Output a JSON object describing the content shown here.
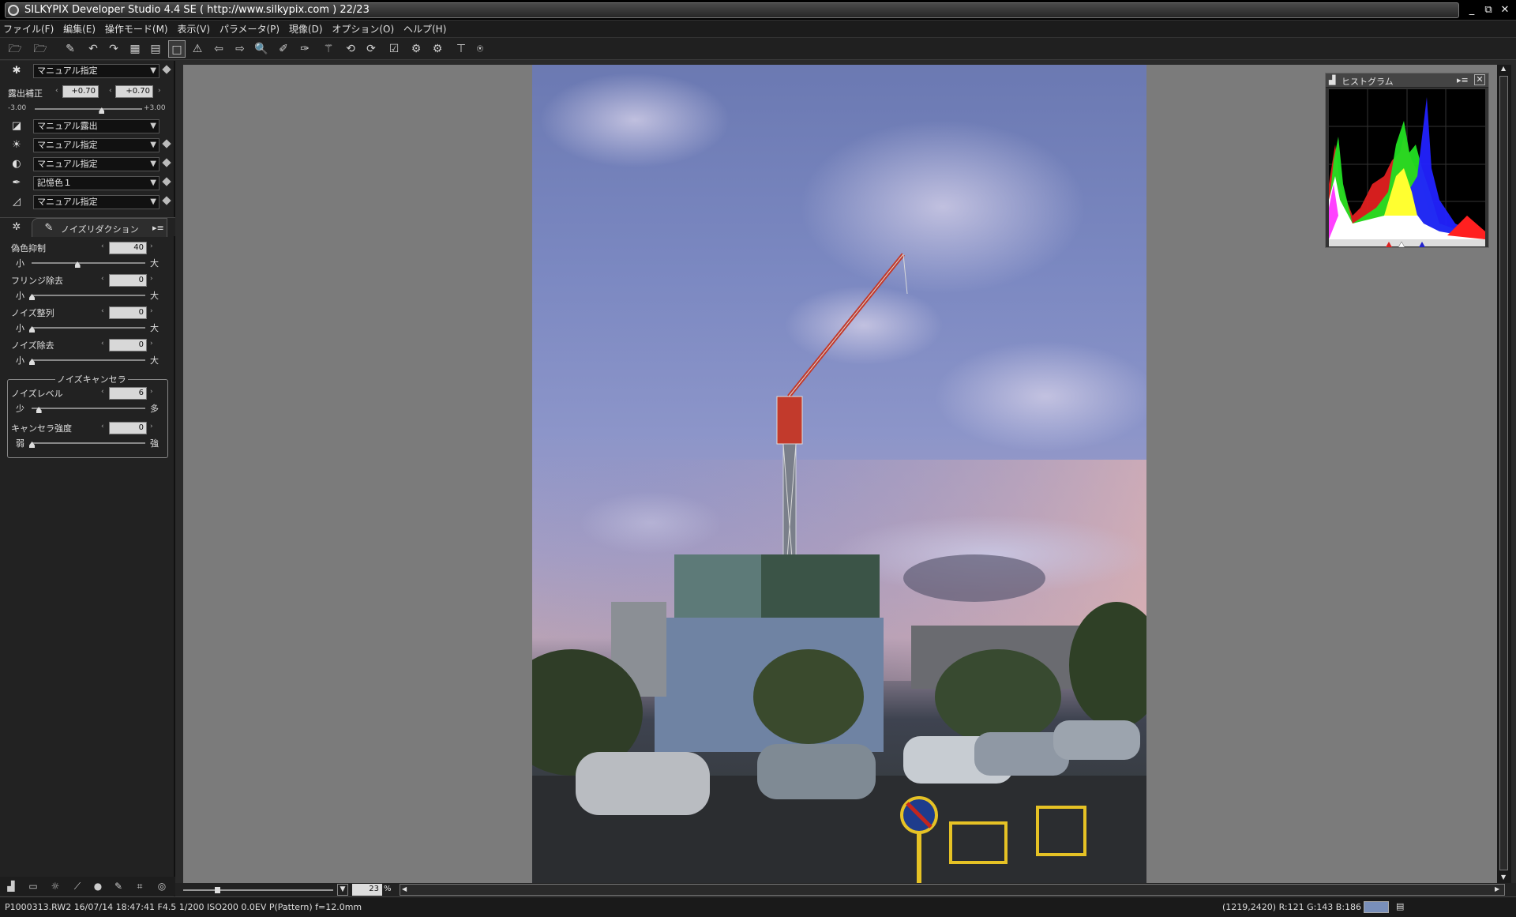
{
  "window": {
    "title": "SILKYPIX Developer Studio 4.4 SE ( http://www.silkypix.com )  22/23",
    "controls": [
      "_",
      "⧉",
      "✕"
    ]
  },
  "menu": [
    "ファイル(F)",
    "編集(E)",
    "操作モード(M)",
    "表示(V)",
    "パラメータ(P)",
    "現像(D)",
    "オプション(O)",
    "ヘルプ(H)"
  ],
  "toolbar_icons": [
    "open-folder-icon",
    "open-folder-dropdown-icon",
    "eraser-icon",
    "undo-icon",
    "redo-icon",
    "grid-view-icon",
    "filmstrip-view-icon",
    "single-view-icon",
    "warning-icon",
    "prev-icon",
    "next-icon",
    "zoom-icon",
    "picker-icon",
    "picker-plus-icon",
    "wand-icon",
    "rotate-left-icon",
    "rotate-right-icon",
    "check-icon",
    "develop-icon",
    "develop-all-icon",
    "crop-icon",
    "stamp-icon"
  ],
  "left_panel": {
    "white_balance": {
      "value": "マニュアル指定"
    },
    "exposure": {
      "label": "露出補正",
      "value1": "+0.70",
      "value2": "+0.70",
      "min": "-3.00",
      "max": "+3.00",
      "level": 0.62
    },
    "exposure_mode": {
      "value": "マニュアル露出"
    },
    "tone": {
      "value": "マニュアル指定"
    },
    "contrast": {
      "value": "マニュアル指定"
    },
    "color": {
      "value": "記憶色１"
    },
    "sharpness": {
      "value": "マニュアル指定"
    },
    "noise_tab": {
      "label": "ノイズリダクション"
    },
    "sliders": [
      {
        "label": "偽色抑制",
        "value": "40",
        "lo": "小",
        "hi": "大",
        "level": 0.4
      },
      {
        "label": "フリンジ除去",
        "value": "0",
        "lo": "小",
        "hi": "大",
        "level": 0.0
      },
      {
        "label": "ノイズ整列",
        "value": "0",
        "lo": "小",
        "hi": "大",
        "level": 0.0
      },
      {
        "label": "ノイズ除去",
        "value": "0",
        "lo": "小",
        "hi": "大",
        "level": 0.0
      }
    ],
    "canceller": {
      "title": "ノイズキャンセラ",
      "sliders": [
        {
          "label": "ノイズレベル",
          "value": "6",
          "lo": "少",
          "hi": "多",
          "level": 0.06
        },
        {
          "label": "キャンセラ強度",
          "value": "0",
          "lo": "弱",
          "hi": "強",
          "level": 0.0
        }
      ]
    }
  },
  "zoom": {
    "value": "23",
    "unit": "%"
  },
  "histogram": {
    "title": "ヒストグラム"
  },
  "status": {
    "left": "P1000313.RW2 16/07/14 18:47:41 F4.5 1/200 ISO200  0.0EV P(Pattern) f=12.0mm",
    "right": "(1219,2420) R:121 G:143 B:186",
    "swatch_color": "#798fba"
  }
}
